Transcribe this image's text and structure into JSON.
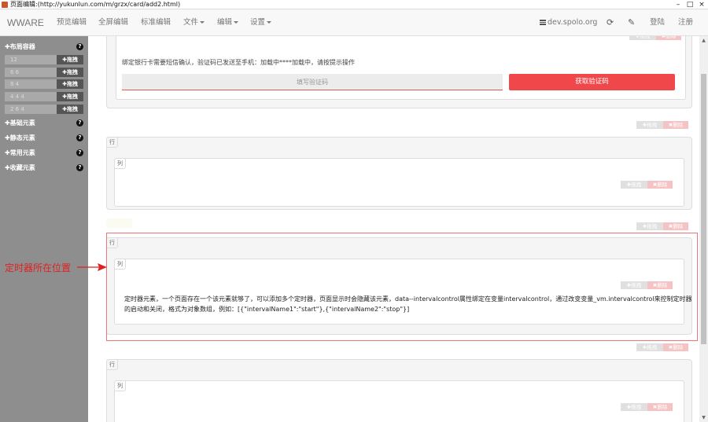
{
  "window": {
    "title": "页面编辑:(http://yukunlun.com/m/grzx/card/add2.html)",
    "minimize": "–",
    "maximize": "□",
    "close": "×"
  },
  "navbar": {
    "brand": "WWARE",
    "items": [
      "预览编辑",
      "全屏编辑",
      "标准编辑",
      "文件",
      "编辑",
      "设置"
    ],
    "domain": "dev.spolo.org",
    "login": "登陆",
    "register": "注册"
  },
  "sidebar": {
    "groups": [
      {
        "label": "布局容器",
        "help": "?"
      },
      {
        "label": "基础元素",
        "help": "?"
      },
      {
        "label": "静态元素",
        "help": "?"
      },
      {
        "label": "常用元素",
        "help": "?"
      },
      {
        "label": "收藏元素",
        "help": "?"
      }
    ],
    "layout_rows": [
      "12",
      "6 6",
      "8 4",
      "4 4 4",
      "2 6 4"
    ],
    "drag_label": "拖拽"
  },
  "canvas": {
    "drag_label": "拖拽",
    "delete_label": "删除",
    "row_tag": "行",
    "col_tag": "列",
    "sms_notice": "绑定银行卡需要短信确认，验证码已发送至手机：加载中****加载中，请按提示操作",
    "sms_placeholder": "填写验证码",
    "sms_button": "获取验证码",
    "timer_text": "定时器元素，一个页面存在一个该元素就够了，可以添加多个定时器，页面显示时会隐藏该元素，data--intervalcontrol属性绑定在变量intervalcontrol，通过改变变量_vm.intervalcontrol来控制定时器的启动和关闭，格式为对象数组，例如：[{\"intervalName1\":\"start\"},{\"intervalName2\":\"stop\"}]"
  },
  "annotation": {
    "text": "定时器所在位置",
    "color": "#e02020"
  },
  "colors": {
    "accent": "#f0484a",
    "sidebar_bg": "#8e8e8e"
  }
}
